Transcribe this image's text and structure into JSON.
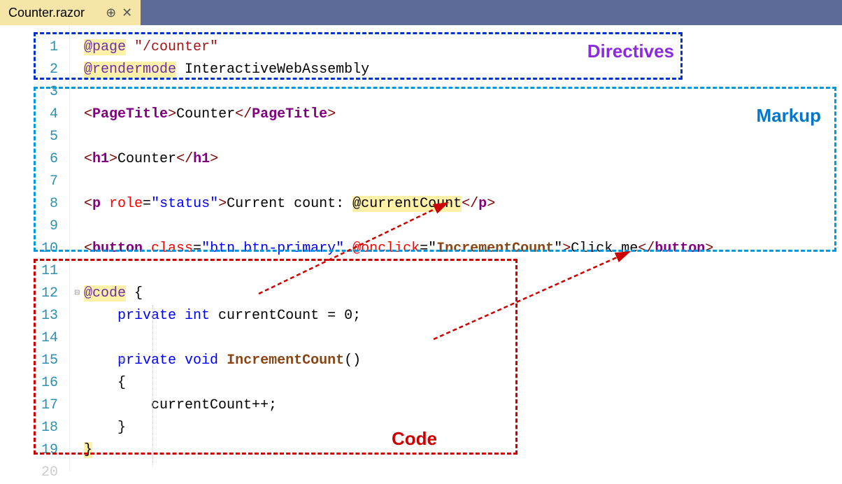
{
  "tab": {
    "filename": "Counter.razor"
  },
  "lineNumbers": [
    "1",
    "2",
    "3",
    "4",
    "5",
    "6",
    "7",
    "8",
    "9",
    "10",
    "11",
    "12",
    "13",
    "14",
    "15",
    "16",
    "17",
    "18",
    "19",
    "20"
  ],
  "annotations": {
    "directives": "Directives",
    "markup": "Markup",
    "code": "Code"
  },
  "code": {
    "l1_dir": "@page",
    "l1_str": "\"/counter\"",
    "l2_dir": "@rendermode",
    "l2_txt": " InteractiveWebAssembly",
    "l4_open1": "<",
    "l4_tag": "PageTitle",
    "l4_close1": ">",
    "l4_content": "Counter",
    "l4_open2": "</",
    "l4_close2": ">",
    "l6_open1": "<",
    "l6_tag": "h1",
    "l6_close1": ">",
    "l6_content": "Counter",
    "l6_open2": "</",
    "l6_close2": ">",
    "l8_open": "<",
    "l8_tag": "p",
    "l8_attr": " role",
    "l8_eq": "=",
    "l8_val": "\"status\"",
    "l8_close": ">",
    "l8_txt": "Current count: ",
    "l8_var": "@currentCount",
    "l8_open2": "</",
    "l8_close2": ">",
    "l10_open": "<",
    "l10_tag": "button",
    "l10_attr1": " class",
    "l10_eq": "=",
    "l10_val1": "\"btn btn-primary\"",
    "l10_attr2": " @onclick",
    "l10_val2_open": "=\"",
    "l10_method": "IncrementCount",
    "l10_val2_close": "\"",
    "l10_close": ">",
    "l10_txt": "Click me",
    "l10_open2": "</",
    "l10_close2": ">",
    "l12_dir": "@code",
    "l12_brace": " {",
    "l13_indent": "    ",
    "l13_kw1": "private",
    "l13_kw2": " int",
    "l13_txt": " currentCount = 0;",
    "l15_indent": "    ",
    "l15_kw1": "private",
    "l15_kw2": " void",
    "l15_sp": " ",
    "l15_method": "IncrementCount",
    "l15_paren": "()",
    "l16_txt": "    {",
    "l17_txt": "        currentCount++;",
    "l18_txt": "    }",
    "l19_brace": "}"
  }
}
